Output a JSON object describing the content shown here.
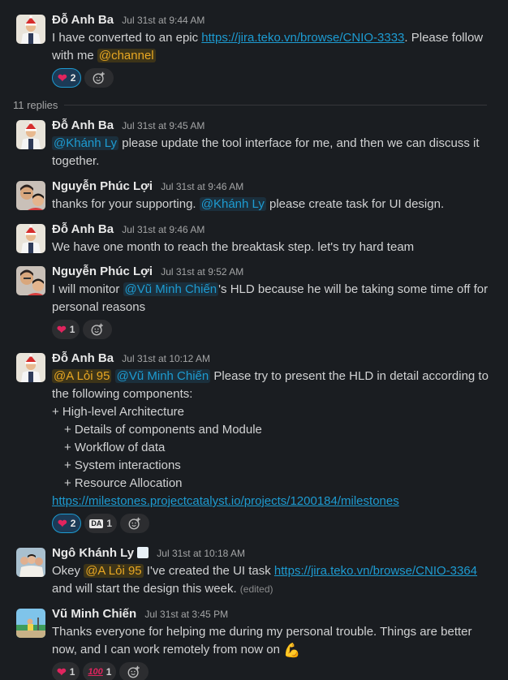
{
  "thread": {
    "replies_label": "11 replies",
    "parent": {
      "author": "Đỗ Anh Ba",
      "time": "Jul 31st at 9:44 AM",
      "text_1": "I have converted to an epic ",
      "link": "https://jira.teko.vn/browse/CNIO-3333",
      "text_2": ". Please follow with me ",
      "mention": "@channel",
      "reaction_heart_count": "2"
    },
    "replies": [
      {
        "author": "Đỗ Anh Ba",
        "time": "Jul 31st at 9:45 AM",
        "mention": "@Khánh Ly",
        "text": " please update the tool interface for me, and then we can discuss it together."
      },
      {
        "author": "Nguyễn Phúc Lợi",
        "time": "Jul 31st at 9:46 AM",
        "text_1": "thanks for your supporting. ",
        "mention": "@Khánh Ly",
        "text_2": " please create task for UI design."
      },
      {
        "author": "Đỗ Anh Ba",
        "time": "Jul 31st at 9:46 AM",
        "text": "We have one month to reach the breaktask step. let's try hard team"
      },
      {
        "author": "Nguyễn Phúc Lợi",
        "time": "Jul 31st at 9:52 AM",
        "text_1": "I will monitor ",
        "mention": "@Vũ Minh Chiến",
        "text_2": "'s HLD because he will be taking some time off for personal reasons",
        "reaction_heart_count": "1"
      },
      {
        "author": "Đỗ Anh Ba",
        "time": "Jul 31st at 10:12 AM",
        "mention_1": "@A Lỏi 95",
        "mention_2": "@Vũ Minh Chiến",
        "text_1": " Please try to present the HLD in detail according to the following components:",
        "bullet_main": "+ High-level Architecture",
        "bullets": [
          "+ Details of components and Module",
          "+ Workflow of data",
          "+ System interactions",
          "+ Resource Allocation"
        ],
        "link": "https://milestones.projectcatalyst.io/projects/1200184/milestones",
        "reaction_heart_count": "2",
        "reaction_da_label": "DA",
        "reaction_da_count": "1"
      },
      {
        "author": "Ngô Khánh Ly",
        "time": "Jul 31st at 10:18 AM",
        "text_1": "Okey ",
        "mention": "@A Lỏi 95",
        "text_2": " I've created the UI task ",
        "link": "https://jira.teko.vn/browse/CNIO-3364",
        "text_3": " and will start the design this week. ",
        "edited": "(edited)"
      },
      {
        "author": "Vũ Minh Chiến",
        "time": "Jul 31st at 3:45 PM",
        "text": "Thanks everyone for helping me during my personal trouble. Things are better now, and I can work remotely from now on ",
        "reaction_heart_count": "1",
        "reaction_100_label": "100",
        "reaction_100_count": "1"
      }
    ]
  },
  "colors": {
    "background": "#1a1d21",
    "link": "#1d9bd1",
    "mention_highlight": "#e8a723",
    "heart": "#e0245e"
  },
  "icons": {
    "heart": "heart-icon",
    "add_reaction": "add-reaction-icon",
    "muscle": "muscle-emoji-icon",
    "status": "status-icon"
  }
}
